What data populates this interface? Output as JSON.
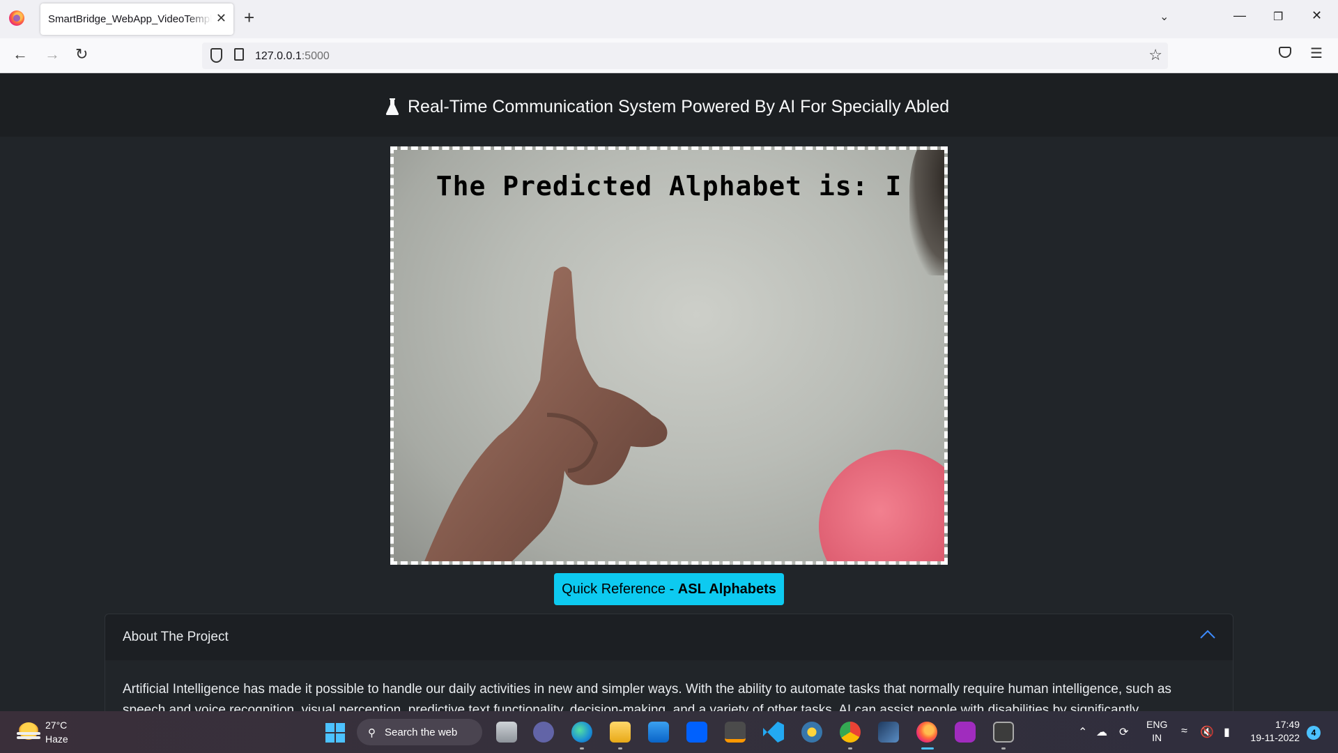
{
  "browser": {
    "tab_title": "SmartBridge_WebApp_VideoTemplate",
    "tab_close": "✕",
    "new_tab": "+",
    "url_host": "127.0.0.1",
    "url_port": ":5000"
  },
  "page": {
    "title": "Real-Time Communication System Powered By AI For Specially Abled",
    "prediction": "The Predicted Alphabet is: I",
    "ref_button_prefix": "Quick Reference - ",
    "ref_button_bold": "ASL Alphabets",
    "accordion": {
      "title": "About The Project",
      "body": "Artificial Intelligence has made it possible to handle our daily activities in new and simpler ways. With the ability to automate tasks that normally require human intelligence, such as speech and voice recognition, visual perception, predictive text functionality, decision-making, and a variety of other tasks, AI can assist people with disabilities by significantly"
    }
  },
  "taskbar": {
    "temperature": "27°C",
    "condition": "Haze",
    "search_label": "Search the web",
    "lang_top": "ENG",
    "lang_bottom": "IN",
    "time": "17:49",
    "date": "19-11-2022",
    "notifications": "4"
  },
  "colors": {
    "page_bg": "#212529",
    "accent_button": "#0dcaf0",
    "chevron": "#3d8bfd"
  }
}
